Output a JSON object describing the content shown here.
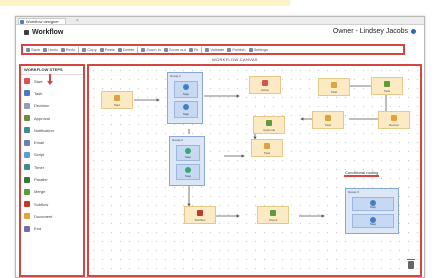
{
  "window_tab": {
    "label": "Workflow designer",
    "close_glyph": "×"
  },
  "app": {
    "title": "Workflow",
    "user": "Owner - Lindsey Jacobs"
  },
  "toolbar": [
    {
      "label": "Save",
      "icon": "save-icon"
    },
    {
      "label": "Undo",
      "icon": "undo-icon"
    },
    {
      "label": "Redo",
      "icon": "redo-icon"
    },
    {
      "label": "Copy",
      "icon": "copy-icon"
    },
    {
      "label": "Paste",
      "icon": "paste-icon"
    },
    {
      "label": "Delete",
      "icon": "delete-icon"
    },
    {
      "label": "Zoom in",
      "icon": "zoom-in-icon"
    },
    {
      "label": "Zoom out",
      "icon": "zoom-out-icon"
    },
    {
      "label": "Fit",
      "icon": "fit-icon"
    },
    {
      "label": "Validate",
      "icon": "validate-icon"
    },
    {
      "label": "Publish",
      "icon": "publish-icon"
    },
    {
      "label": "Settings",
      "icon": "gear-icon"
    }
  ],
  "canvas_title": "WORKFLOW CANVAS",
  "palette": {
    "title": "WORKFLOW STEPS",
    "items": [
      {
        "label": "Start",
        "icon": "start-icon",
        "color": "#d9534f"
      },
      {
        "label": "Task",
        "icon": "task-icon",
        "color": "#4a7cc0"
      },
      {
        "label": "Decision",
        "icon": "decision-icon",
        "color": "#8e9fb8"
      },
      {
        "label": "Approval",
        "icon": "approval-icon",
        "color": "#6b8e3d"
      },
      {
        "label": "Notification",
        "icon": "notification-icon",
        "color": "#3a8f8f"
      },
      {
        "label": "Email",
        "icon": "email-icon",
        "color": "#6a7fb5"
      },
      {
        "label": "Script",
        "icon": "script-icon",
        "color": "#5aa0d6"
      },
      {
        "label": "Timer",
        "icon": "timer-icon",
        "color": "#3a8f8f"
      },
      {
        "label": "Parallel",
        "icon": "parallel-icon",
        "color": "#2e7d32"
      },
      {
        "label": "Merge",
        "icon": "merge-icon",
        "color": "#5c9d3b"
      },
      {
        "label": "Subflow",
        "icon": "subflow-icon",
        "color": "#c0392b"
      },
      {
        "label": "Document",
        "icon": "document-icon",
        "color": "#e0a43a"
      },
      {
        "label": "End",
        "icon": "end-icon",
        "color": "#7b6aa8"
      }
    ]
  },
  "nodes": [
    {
      "name": "node-start",
      "label": "Start",
      "color": "#d9a53f"
    },
    {
      "name": "node-red-action",
      "label": "Action",
      "color": "#d9534f"
    },
    {
      "name": "node-task-a",
      "label": "Task",
      "color": "#d9a53f"
    },
    {
      "name": "node-task-b",
      "label": "Task",
      "color": "#5c9d3b"
    },
    {
      "name": "node-approval",
      "label": "Approval",
      "color": "#5c9d3b"
    },
    {
      "name": "node-task-c",
      "label": "Task",
      "color": "#d9a53f"
    },
    {
      "name": "node-review",
      "label": "Review",
      "color": "#e0a43a"
    },
    {
      "name": "node-task-d",
      "label": "Task",
      "color": "#d9a53f"
    },
    {
      "name": "node-check",
      "label": "Check",
      "color": "#5c9d3b"
    },
    {
      "name": "node-subflow",
      "label": "Subflow",
      "color": "#c0392b"
    }
  ],
  "groups": [
    {
      "title": "Group 1",
      "children": [
        "Step",
        "Step"
      ]
    },
    {
      "title": "Group 2",
      "children": [
        "Step",
        "Step"
      ]
    },
    {
      "title": "Group 3",
      "children": [
        "Step",
        "Step"
      ]
    }
  ],
  "annotation": "Conditional routing"
}
